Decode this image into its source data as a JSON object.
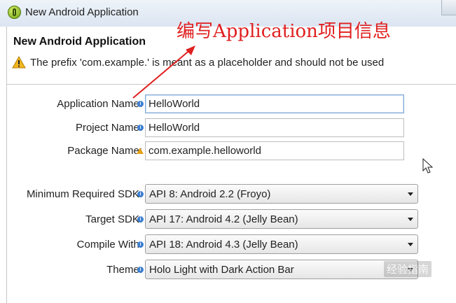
{
  "window": {
    "title": "New Android Application"
  },
  "header": {
    "title": "New Android Application",
    "warning": "The prefix 'com.example.' is meant as a placeholder and should not be used"
  },
  "annotation": {
    "text": "编写Application项目信息",
    "color": "#e02020"
  },
  "form": {
    "application_name": {
      "label": "Application Name:",
      "value": "HelloWorld",
      "hint_icon": "info-icon"
    },
    "project_name": {
      "label": "Project Name:",
      "value": "HelloWorld",
      "hint_icon": "info-icon"
    },
    "package_name": {
      "label": "Package Name:",
      "value": "com.example.helloworld",
      "hint_icon": "warning-icon"
    },
    "min_sdk": {
      "label": "Minimum Required SDK:",
      "value": "API 8: Android 2.2 (Froyo)"
    },
    "target_sdk": {
      "label": "Target SDK:",
      "value": "API 17: Android 4.2 (Jelly Bean)"
    },
    "compile_with": {
      "label": "Compile With:",
      "value": "API 18: Android 4.3 (Jelly Bean)"
    },
    "theme": {
      "label": "Theme:",
      "value": "Holo Light with Dark Action Bar"
    }
  },
  "watermark": {
    "text": "经验指南"
  }
}
